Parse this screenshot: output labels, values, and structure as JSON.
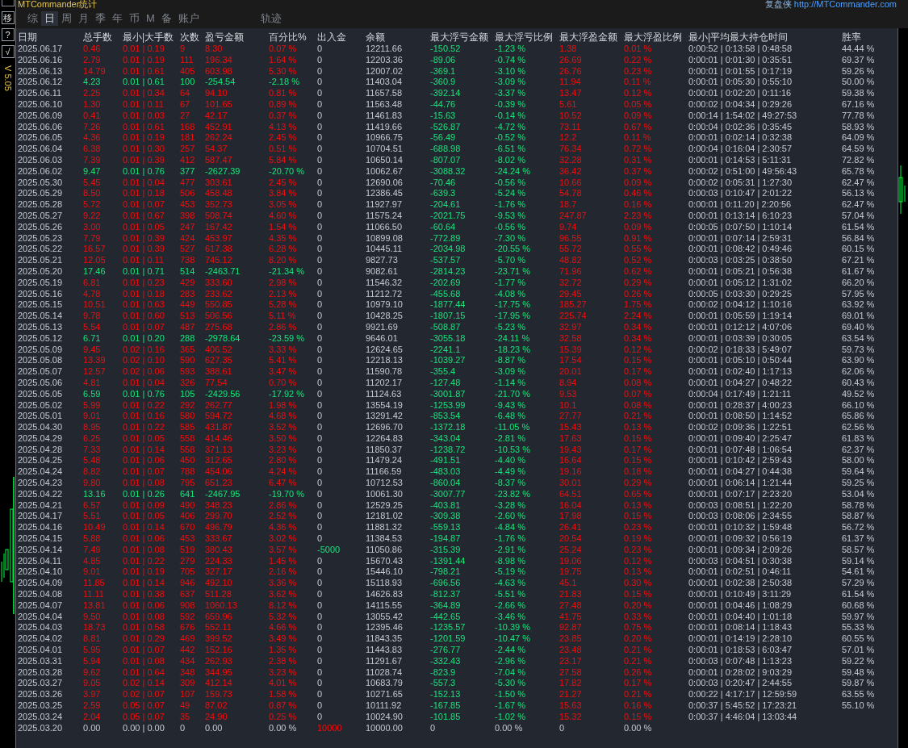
{
  "window": {
    "title": "MTCommander统计",
    "brand": "复盘侠",
    "link": "http://MTCommander.com"
  },
  "side_buttons": [
    "移",
    "?",
    "√"
  ],
  "version": "V 5.05",
  "tabs": [
    {
      "label": "综",
      "selected": false
    },
    {
      "label": "日",
      "selected": true
    },
    {
      "label": "周",
      "selected": false
    },
    {
      "label": "月",
      "selected": false
    },
    {
      "label": "季",
      "selected": false
    },
    {
      "label": "年",
      "selected": false
    },
    {
      "label": "币",
      "selected": false
    },
    {
      "label": "M",
      "selected": false
    },
    {
      "label": "备",
      "selected": false
    },
    {
      "label": "账户",
      "selected": false
    },
    {
      "label": "轨迹",
      "selected": false
    }
  ],
  "table": {
    "columns": [
      "日期",
      "总手数",
      "最小|大手数",
      "次数",
      "盈亏金额",
      "百分比%",
      "出入金",
      "余额",
      "最大浮亏金额",
      "最大浮亏比例",
      "最大浮盈金额",
      "最大浮盈比例",
      "最小|平均最大持仓时间",
      "胜率"
    ],
    "rows": [
      {
        "kind": "gain",
        "deposit": false,
        "withdrawal": false,
        "cells": [
          "2025.06.17",
          "0.46",
          "0.01 | 0.19",
          "9",
          "8.30",
          "0.07 %",
          "0",
          "12211.66",
          "-150.52",
          "-1.23 %",
          "1.38",
          "0.01 %",
          "0:00:52 | 0:13:58 | 0:48:58",
          "44.44 %"
        ]
      },
      {
        "kind": "gain",
        "deposit": false,
        "withdrawal": false,
        "cells": [
          "2025.06.16",
          "2.79",
          "0.01 | 0.19",
          "111",
          "196.34",
          "1.64 %",
          "0",
          "12203.36",
          "-89.06",
          "-0.74 %",
          "26.69",
          "0.22 %",
          "0:00:01 | 0:01:30 | 0:35:51",
          "69.37 %"
        ]
      },
      {
        "kind": "gain",
        "deposit": false,
        "withdrawal": false,
        "cells": [
          "2025.06.13",
          "14.79",
          "0.01 | 0.61",
          "405",
          "603.98",
          "5.30 %",
          "0",
          "12007.02",
          "-369.1",
          "-3.10 %",
          "26.76",
          "0.23 %",
          "0:00:01 | 0:01:55 | 0:17:19",
          "59.26 %"
        ]
      },
      {
        "kind": "loss",
        "deposit": false,
        "withdrawal": false,
        "cells": [
          "2025.06.12",
          "4.23",
          "0.01 | 0.61",
          "100",
          "-254.54",
          "-2.18 %",
          "0",
          "11403.04",
          "-360.9",
          "-3.09 %",
          "11.94",
          "0.11 %",
          "0:00:01 | 0:05:30 | 0:55:10",
          "50.00 %"
        ]
      },
      {
        "kind": "gain",
        "deposit": false,
        "withdrawal": false,
        "cells": [
          "2025.06.11",
          "2.25",
          "0.01 | 0.34",
          "64",
          "94.10",
          "0.81 %",
          "0",
          "11657.58",
          "-392.14",
          "-3.37 %",
          "13.47",
          "0.12 %",
          "0:00:01 | 0:02:20 | 0:11:16",
          "59.38 %"
        ]
      },
      {
        "kind": "gain",
        "deposit": false,
        "withdrawal": false,
        "cells": [
          "2025.06.10",
          "1.30",
          "0.01 | 0.11",
          "67",
          "101.65",
          "0.89 %",
          "0",
          "11563.48",
          "-44.76",
          "-0.39 %",
          "5.61",
          "0.05 %",
          "0:00:02 | 0:04:34 | 0:29:26",
          "67.16 %"
        ]
      },
      {
        "kind": "gain",
        "deposit": false,
        "withdrawal": false,
        "cells": [
          "2025.06.09",
          "0.41",
          "0.01 | 0.03",
          "27",
          "42.17",
          "0.37 %",
          "0",
          "11461.83",
          "-15.63",
          "-0.14 %",
          "10.52",
          "0.09 %",
          "0:00:14 | 1:54:02 | 49:27:53",
          "77.78 %"
        ]
      },
      {
        "kind": "gain",
        "deposit": false,
        "withdrawal": false,
        "cells": [
          "2025.06.06",
          "7.26",
          "0.01 | 0.61",
          "168",
          "452.91",
          "4.13 %",
          "0",
          "11419.66",
          "-526.87",
          "-4.72 %",
          "73.11",
          "0.67 %",
          "0:00:04 | 0:02:36 | 0:35:45",
          "58.93 %"
        ]
      },
      {
        "kind": "gain",
        "deposit": false,
        "withdrawal": false,
        "cells": [
          "2025.06.05",
          "4.36",
          "0.01 | 0.19",
          "181",
          "262.24",
          "2.45 %",
          "0",
          "10966.75",
          "-56.49",
          "-0.52 %",
          "12.2",
          "0.11 %",
          "0:00:01 | 0:02:14 | 0:32:38",
          "64.09 %"
        ]
      },
      {
        "kind": "gain",
        "deposit": false,
        "withdrawal": false,
        "cells": [
          "2025.06.04",
          "6.38",
          "0.01 | 0.30",
          "257",
          "54.37",
          "0.51 %",
          "0",
          "10704.51",
          "-688.98",
          "-6.51 %",
          "76.34",
          "0.72 %",
          "0:00:04 | 0:16:04 | 2:30:57",
          "64.59 %"
        ]
      },
      {
        "kind": "gain",
        "deposit": false,
        "withdrawal": false,
        "cells": [
          "2025.06.03",
          "7.39",
          "0.01 | 0.39",
          "412",
          "587.47",
          "5.84 %",
          "0",
          "10650.14",
          "-807.07",
          "-8.02 %",
          "32.28",
          "0.31 %",
          "0:00:01 | 0:14:53 | 5:11:31",
          "72.82 %"
        ]
      },
      {
        "kind": "loss",
        "deposit": false,
        "withdrawal": false,
        "cells": [
          "2025.06.02",
          "9.47",
          "0.01 | 0.76",
          "377",
          "-2627.39",
          "-20.70 %",
          "0",
          "10062.67",
          "-3088.32",
          "-24.24 %",
          "36.42",
          "0.37 %",
          "0:00:02 | 0:51:00 | 49:56:43",
          "65.78 %"
        ]
      },
      {
        "kind": "gain",
        "deposit": false,
        "withdrawal": false,
        "cells": [
          "2025.05.30",
          "5.45",
          "0.01 | 0.04",
          "477",
          "303.61",
          "2.45 %",
          "0",
          "12690.06",
          "-70.46",
          "-0.56 %",
          "10.66",
          "0.09 %",
          "0:00:02 | 0:05:31 | 1:27:30",
          "62.47 %"
        ]
      },
      {
        "kind": "gain",
        "deposit": false,
        "withdrawal": false,
        "cells": [
          "2025.05.29",
          "8.50",
          "0.01 | 0.18",
          "506",
          "458.48",
          "3.84 %",
          "0",
          "12386.45",
          "-639.3",
          "-5.24 %",
          "54.78",
          "0.46 %",
          "0:00:03 | 0:10:47 | 2:01:22",
          "56.13 %"
        ]
      },
      {
        "kind": "gain",
        "deposit": false,
        "withdrawal": false,
        "cells": [
          "2025.05.28",
          "5.72",
          "0.01 | 0.07",
          "453",
          "352.73",
          "3.05 %",
          "0",
          "11927.97",
          "-204.61",
          "-1.76 %",
          "18.7",
          "0.16 %",
          "0:00:01 | 0:11:20 | 2:20:56",
          "62.47 %"
        ]
      },
      {
        "kind": "gain",
        "deposit": false,
        "withdrawal": false,
        "cells": [
          "2025.05.27",
          "9.22",
          "0.01 | 0.67",
          "398",
          "508.74",
          "4.60 %",
          "0",
          "11575.24",
          "-2021.75",
          "-9.53 %",
          "247.87",
          "2.23 %",
          "0:00:01 | 0:13:14 | 6:10:23",
          "57.04 %"
        ]
      },
      {
        "kind": "gain",
        "deposit": false,
        "withdrawal": false,
        "cells": [
          "2025.05.26",
          "3.00",
          "0.01 | 0.05",
          "247",
          "167.42",
          "1.54 %",
          "0",
          "11066.50",
          "-60.64",
          "-0.56 %",
          "9.74",
          "0.09 %",
          "0:00:05 | 0:07:50 | 1:10:14",
          "61.54 %"
        ]
      },
      {
        "kind": "gain",
        "deposit": false,
        "withdrawal": false,
        "cells": [
          "2025.05.23",
          "7.79",
          "0.01 | 0.39",
          "424",
          "453.97",
          "4.35 %",
          "0",
          "10899.08",
          "-772.89",
          "-7.30 %",
          "96.55",
          "0.91 %",
          "0:00:01 | 0:07:14 | 2:59:31",
          "56.84 %"
        ]
      },
      {
        "kind": "gain",
        "deposit": false,
        "withdrawal": false,
        "cells": [
          "2025.05.22",
          "16.57",
          "0.01 | 0.39",
          "527",
          "617.38",
          "6.28 %",
          "0",
          "10445.11",
          "-2034.98",
          "-20.55 %",
          "55.72",
          "0.55 %",
          "0:00:01 | 0:08:42 | 0:49:46",
          "60.15 %"
        ]
      },
      {
        "kind": "gain",
        "deposit": false,
        "withdrawal": false,
        "cells": [
          "2025.05.21",
          "12.05",
          "0.01 | 0.11",
          "738",
          "745.12",
          "8.20 %",
          "0",
          "9827.73",
          "-537.57",
          "-5.70 %",
          "48.82",
          "0.52 %",
          "0:00:03 | 0:03:25 | 0:38:50",
          "67.21 %"
        ]
      },
      {
        "kind": "loss",
        "deposit": false,
        "withdrawal": false,
        "cells": [
          "2025.05.20",
          "17.46",
          "0.01 | 0.71",
          "514",
          "-2463.71",
          "-21.34 %",
          "0",
          "9082.61",
          "-2814.23",
          "-23.71 %",
          "71.96",
          "0.62 %",
          "0:00:01 | 0:05:21 | 0:56:38",
          "61.67 %"
        ]
      },
      {
        "kind": "gain",
        "deposit": false,
        "withdrawal": false,
        "cells": [
          "2025.05.19",
          "6.81",
          "0.01 | 0.23",
          "429",
          "333.60",
          "2.98 %",
          "0",
          "11546.32",
          "-202.69",
          "-1.77 %",
          "32.72",
          "0.29 %",
          "0:00:01 | 0:05:12 | 1:31:02",
          "66.20 %"
        ]
      },
      {
        "kind": "gain",
        "deposit": false,
        "withdrawal": false,
        "cells": [
          "2025.05.16",
          "4.78",
          "0.01 | 0.18",
          "283",
          "233.62",
          "2.13 %",
          "0",
          "11212.72",
          "-455.68",
          "-4.08 %",
          "29.45",
          "0.26 %",
          "0:00:05 | 0:03:30 | 0:29:25",
          "57.95 %"
        ]
      },
      {
        "kind": "gain",
        "deposit": false,
        "withdrawal": false,
        "cells": [
          "2025.05.15",
          "10.51",
          "0.01 | 0.63",
          "449",
          "550.85",
          "5.28 %",
          "0",
          "10979.10",
          "-1877.44",
          "-17.75 %",
          "185.27",
          "1.75 %",
          "0:00:02 | 0:04:12 | 1:10:16",
          "63.92 %"
        ]
      },
      {
        "kind": "gain",
        "deposit": false,
        "withdrawal": false,
        "cells": [
          "2025.05.14",
          "9.78",
          "0.01 | 0.60",
          "513",
          "506.56",
          "5.11 %",
          "0",
          "10428.25",
          "-1807.15",
          "-17.95 %",
          "225.74",
          "2.24 %",
          "0:00:01 | 0:05:59 | 1:19:14",
          "69.01 %"
        ]
      },
      {
        "kind": "gain",
        "deposit": false,
        "withdrawal": false,
        "cells": [
          "2025.05.13",
          "5.54",
          "0.01 | 0.07",
          "487",
          "275.68",
          "2.86 %",
          "0",
          "9921.69",
          "-508.87",
          "-5.23 %",
          "32.97",
          "0.34 %",
          "0:00:01 | 0:12:12 | 4:07:06",
          "69.40 %"
        ]
      },
      {
        "kind": "loss",
        "deposit": false,
        "withdrawal": false,
        "cells": [
          "2025.05.12",
          "6.71",
          "0.01 | 0.20",
          "288",
          "-2978.64",
          "-23.59 %",
          "0",
          "9646.01",
          "-3055.18",
          "-24.11 %",
          "32.58",
          "0.34 %",
          "0:00:01 | 0:03:39 | 0:30:05",
          "63.54 %"
        ]
      },
      {
        "kind": "gain",
        "deposit": false,
        "withdrawal": false,
        "cells": [
          "2025.05.09",
          "9.45",
          "0.02 | 0.16",
          "365",
          "406.52",
          "3.33 %",
          "0",
          "12624.65",
          "-2241.1",
          "-18.23 %",
          "15.39",
          "0.12 %",
          "0:00:02 | 0:18:33 | 5:49:07",
          "59.73 %"
        ]
      },
      {
        "kind": "gain",
        "deposit": false,
        "withdrawal": false,
        "cells": [
          "2025.05.08",
          "13.39",
          "0.02 | 0.10",
          "590",
          "627.35",
          "5.41 %",
          "0",
          "12218.13",
          "-1039.27",
          "-8.87 %",
          "17.54",
          "0.15 %",
          "0:00:01 | 0:05:10 | 0:50:44",
          "63.90 %"
        ]
      },
      {
        "kind": "gain",
        "deposit": false,
        "withdrawal": false,
        "cells": [
          "2025.05.07",
          "12.57",
          "0.02 | 0.06",
          "593",
          "388.61",
          "3.47 %",
          "0",
          "11590.78",
          "-355.4",
          "-3.09 %",
          "20.01",
          "0.17 %",
          "0:00:01 | 0:02:40 | 1:17:13",
          "62.06 %"
        ]
      },
      {
        "kind": "gain",
        "deposit": false,
        "withdrawal": false,
        "cells": [
          "2025.05.06",
          "4.81",
          "0.01 | 0.04",
          "326",
          "77.54",
          "0.70 %",
          "0",
          "11202.17",
          "-127.48",
          "-1.14 %",
          "8.94",
          "0.08 %",
          "0:00:01 | 0:04:27 | 0:48:22",
          "60.43 %"
        ]
      },
      {
        "kind": "loss",
        "deposit": false,
        "withdrawal": false,
        "cells": [
          "2025.05.05",
          "6.59",
          "0.01 | 0.76",
          "105",
          "-2429.56",
          "-17.92 %",
          "0",
          "11124.63",
          "-3001.87",
          "-21.70 %",
          "9.53",
          "0.07 %",
          "0:00:04 | 0:17:49 | 1:21:11",
          "49.52 %"
        ]
      },
      {
        "kind": "gain",
        "deposit": false,
        "withdrawal": false,
        "cells": [
          "2025.05.02",
          "5.99",
          "0.01 | 0.22",
          "292",
          "262.77",
          "1.98 %",
          "0",
          "13554.19",
          "-1253.99",
          "-9.43 %",
          "10.1",
          "0.08 %",
          "0:00:01 | 0:28:37 | 4:00:23",
          "66.10 %"
        ]
      },
      {
        "kind": "gain",
        "deposit": false,
        "withdrawal": false,
        "cells": [
          "2025.05.01",
          "9.01",
          "0.01 | 0.16",
          "580",
          "594.72",
          "4.68 %",
          "0",
          "13291.42",
          "-853.54",
          "-6.48 %",
          "27.77",
          "0.21 %",
          "0:00:01 | 0:08:50 | 1:14:52",
          "65.86 %"
        ]
      },
      {
        "kind": "gain",
        "deposit": false,
        "withdrawal": false,
        "cells": [
          "2025.04.30",
          "8.95",
          "0.01 | 0.22",
          "585",
          "431.87",
          "3.52 %",
          "0",
          "12696.70",
          "-1372.18",
          "-11.05 %",
          "15.43",
          "0.13 %",
          "0:00:02 | 0:09:36 | 1:22:51",
          "62.56 %"
        ]
      },
      {
        "kind": "gain",
        "deposit": false,
        "withdrawal": false,
        "cells": [
          "2025.04.29",
          "6.25",
          "0.01 | 0.05",
          "558",
          "414.46",
          "3.50 %",
          "0",
          "12264.83",
          "-343.04",
          "-2.81 %",
          "17.63",
          "0.15 %",
          "0:00:01 | 0:09:40 | 2:25:47",
          "61.83 %"
        ]
      },
      {
        "kind": "gain",
        "deposit": false,
        "withdrawal": false,
        "cells": [
          "2025.04.28",
          "7.33",
          "0.01 | 0.14",
          "558",
          "371.13",
          "3.23 %",
          "0",
          "11850.37",
          "-1238.72",
          "-10.53 %",
          "19.43",
          "0.17 %",
          "0:00:01 | 0:07:48 | 1:06:54",
          "62.37 %"
        ]
      },
      {
        "kind": "gain",
        "deposit": false,
        "withdrawal": false,
        "cells": [
          "2025.04.25",
          "5.48",
          "0.01 | 0.06",
          "450",
          "312.65",
          "2.80 %",
          "0",
          "11479.24",
          "-491.51",
          "-4.40 %",
          "16.64",
          "0.15 %",
          "0:00:01 | 0:10:42 | 2:59:43",
          "58.00 %"
        ]
      },
      {
        "kind": "gain",
        "deposit": false,
        "withdrawal": false,
        "cells": [
          "2025.04.24",
          "8.82",
          "0.01 | 0.07",
          "788",
          "454.06",
          "4.24 %",
          "0",
          "11166.59",
          "-483.03",
          "-4.49 %",
          "19.16",
          "0.18 %",
          "0:00:01 | 0:04:27 | 0:44:38",
          "59.64 %"
        ]
      },
      {
        "kind": "gain",
        "deposit": false,
        "withdrawal": false,
        "cells": [
          "2025.04.23",
          "9.80",
          "0.01 | 0.08",
          "795",
          "651.23",
          "6.47 %",
          "0",
          "10712.53",
          "-860.04",
          "-8.37 %",
          "30.01",
          "0.29 %",
          "0:00:01 | 0:06:14 | 1:21:44",
          "59.25 %"
        ]
      },
      {
        "kind": "loss",
        "deposit": false,
        "withdrawal": false,
        "cells": [
          "2025.04.22",
          "13.16",
          "0.01 | 0.26",
          "641",
          "-2467.95",
          "-19.70 %",
          "0",
          "10061.30",
          "-3007.77",
          "-23.82 %",
          "64.51",
          "0.65 %",
          "0:00:01 | 0:07:17 | 2:23:20",
          "53.04 %"
        ]
      },
      {
        "kind": "gain",
        "deposit": false,
        "withdrawal": false,
        "cells": [
          "2025.04.21",
          "6.57",
          "0.01 | 0.09",
          "490",
          "348.23",
          "2.86 %",
          "0",
          "12529.25",
          "-403.81",
          "-3.28 %",
          "16.04",
          "0.13 %",
          "0:00:03 | 0:08:51 | 1:22:20",
          "58.78 %"
        ]
      },
      {
        "kind": "gain",
        "deposit": false,
        "withdrawal": false,
        "cells": [
          "2025.04.17",
          "5.51",
          "0.01 | 0.05",
          "406",
          "299.70",
          "2.52 %",
          "0",
          "12181.02",
          "-309.38",
          "-2.60 %",
          "17.98",
          "0.15 %",
          "0:00:03 | 0:08:06 | 2:34:55",
          "58.87 %"
        ]
      },
      {
        "kind": "gain",
        "deposit": false,
        "withdrawal": false,
        "cells": [
          "2025.04.16",
          "10.49",
          "0.01 | 0.14",
          "670",
          "496.79",
          "4.36 %",
          "0",
          "11881.32",
          "-559.13",
          "-4.84 %",
          "26.41",
          "0.23 %",
          "0:00:01 | 0:10:32 | 1:59:48",
          "56.72 %"
        ]
      },
      {
        "kind": "gain",
        "deposit": false,
        "withdrawal": false,
        "cells": [
          "2025.04.15",
          "5.88",
          "0.01 | 0.06",
          "453",
          "333.67",
          "3.02 %",
          "0",
          "11384.53",
          "-194.87",
          "-1.76 %",
          "20.54",
          "0.19 %",
          "0:00:01 | 0:09:32 | 0:56:19",
          "61.37 %"
        ]
      },
      {
        "kind": "gain",
        "deposit": false,
        "withdrawal": true,
        "cells": [
          "2025.04.14",
          "7.49",
          "0.01 | 0.08",
          "519",
          "380.43",
          "3.57 %",
          "-5000",
          "11050.86",
          "-315.39",
          "-2.91 %",
          "25.24",
          "0.23 %",
          "0:00:01 | 0:09:34 | 2:09:26",
          "58.57 %"
        ]
      },
      {
        "kind": "gain",
        "deposit": false,
        "withdrawal": false,
        "cells": [
          "2025.04.11",
          "4.85",
          "0.01 | 0.22",
          "279",
          "224.33",
          "1.45 %",
          "0",
          "15670.43",
          "-1391.44",
          "-8.98 %",
          "19.06",
          "0.12 %",
          "0:00:03 | 0:04:51 | 0:30:38",
          "59.14 %"
        ]
      },
      {
        "kind": "gain",
        "deposit": false,
        "withdrawal": false,
        "cells": [
          "2025.04.10",
          "9.01",
          "0.01 | 0.19",
          "705",
          "327.17",
          "2.16 %",
          "0",
          "15446.10",
          "-798.21",
          "-5.19 %",
          "19.75",
          "0.13 %",
          "0:00:01 | 0:02:51 | 0:46:11",
          "54.61 %"
        ]
      },
      {
        "kind": "gain",
        "deposit": false,
        "withdrawal": false,
        "cells": [
          "2025.04.09",
          "11.85",
          "0.01 | 0.14",
          "946",
          "492.10",
          "3.36 %",
          "0",
          "15118.93",
          "-696.56",
          "-4.63 %",
          "45.1",
          "0.30 %",
          "0:00:01 | 0:02:38 | 2:50:38",
          "57.29 %"
        ]
      },
      {
        "kind": "gain",
        "deposit": false,
        "withdrawal": false,
        "cells": [
          "2025.04.08",
          "11.11",
          "0.01 | 0.38",
          "637",
          "511.28",
          "3.62 %",
          "0",
          "14626.83",
          "-812.37",
          "-5.51 %",
          "21.83",
          "0.15 %",
          "0:00:01 | 0:10:49 | 3:11:29",
          "61.54 %"
        ]
      },
      {
        "kind": "gain",
        "deposit": false,
        "withdrawal": false,
        "cells": [
          "2025.04.07",
          "13.81",
          "0.01 | 0.06",
          "908",
          "1060.13",
          "8.12 %",
          "0",
          "14115.55",
          "-364.89",
          "-2.66 %",
          "27.48",
          "0.20 %",
          "0:00:01 | 0:04:46 | 1:08:29",
          "60.68 %"
        ]
      },
      {
        "kind": "gain",
        "deposit": false,
        "withdrawal": false,
        "cells": [
          "2025.04.04",
          "9.50",
          "0.01 | 0.08",
          "592",
          "659.96",
          "5.32 %",
          "0",
          "13055.42",
          "-442.65",
          "-3.46 %",
          "41.75",
          "0.33 %",
          "0:00:01 | 0:04:40 | 1:01:18",
          "59.97 %"
        ]
      },
      {
        "kind": "gain",
        "deposit": false,
        "withdrawal": false,
        "cells": [
          "2025.04.03",
          "18.73",
          "0.01 | 0.58",
          "676",
          "552.11",
          "4.66 %",
          "0",
          "12395.46",
          "-1235.57",
          "-10.39 %",
          "92.87",
          "0.75 %",
          "0:00:01 | 0:08:14 | 1:18:43",
          "55.33 %"
        ]
      },
      {
        "kind": "gain",
        "deposit": false,
        "withdrawal": false,
        "cells": [
          "2025.04.02",
          "8.81",
          "0.01 | 0.29",
          "469",
          "399.52",
          "3.49 %",
          "0",
          "11843.35",
          "-1201.59",
          "-10.47 %",
          "23.85",
          "0.20 %",
          "0:00:01 | 0:14:19 | 2:28:10",
          "60.55 %"
        ]
      },
      {
        "kind": "gain",
        "deposit": false,
        "withdrawal": false,
        "cells": [
          "2025.04.01",
          "5.95",
          "0.01 | 0.07",
          "442",
          "152.16",
          "1.35 %",
          "0",
          "11443.83",
          "-276.77",
          "-2.44 %",
          "23.48",
          "0.21 %",
          "0:00:01 | 0:18:53 | 6:03:47",
          "57.01 %"
        ]
      },
      {
        "kind": "gain",
        "deposit": false,
        "withdrawal": false,
        "cells": [
          "2025.03.31",
          "5.94",
          "0.01 | 0.08",
          "434",
          "262.93",
          "2.38 %",
          "0",
          "11291.67",
          "-332.43",
          "-2.96 %",
          "23.17",
          "0.21 %",
          "0:00:03 | 0:07:48 | 1:13:23",
          "59.22 %"
        ]
      },
      {
        "kind": "gain",
        "deposit": false,
        "withdrawal": false,
        "cells": [
          "2025.03.28",
          "9.62",
          "0.01 | 0.64",
          "348",
          "344.95",
          "3.23 %",
          "0",
          "11028.74",
          "-823.9",
          "-7.04 %",
          "27.58",
          "0.26 %",
          "0:00:01 | 0:28:02 | 9:03:29",
          "59.48 %"
        ]
      },
      {
        "kind": "gain",
        "deposit": false,
        "withdrawal": false,
        "cells": [
          "2025.03.27",
          "9.05",
          "0.02 | 0.14",
          "309",
          "412.14",
          "4.01 %",
          "0",
          "10683.79",
          "-557.3",
          "-5.30 %",
          "17.82",
          "0.17 %",
          "0:00:03 | 0:20:47 | 2:44:55",
          "59.87 %"
        ]
      },
      {
        "kind": "gain",
        "deposit": false,
        "withdrawal": false,
        "cells": [
          "2025.03.26",
          "3.97",
          "0.02 | 0.07",
          "107",
          "159.73",
          "1.58 %",
          "0",
          "10271.65",
          "-152.13",
          "-1.50 %",
          "21.27",
          "0.21 %",
          "0:00:22 | 4:17:17 | 12:59:59",
          "63.55 %"
        ]
      },
      {
        "kind": "gain",
        "deposit": false,
        "withdrawal": false,
        "cells": [
          "2025.03.25",
          "2.59",
          "0.05 | 0.07",
          "49",
          "87.02",
          "0.87 %",
          "0",
          "10111.92",
          "-167.85",
          "-1.67 %",
          "15.63",
          "0.16 %",
          "0:00:37 | 5:45:52 | 17:23:21",
          "55.10 %"
        ]
      },
      {
        "kind": "gain",
        "deposit": false,
        "withdrawal": false,
        "cells": [
          "2025.03.24",
          "2.04",
          "0.05 | 0.07",
          "35",
          "24.90",
          "0.25 %",
          "0",
          "10024.90",
          "-101.85",
          "-1.02 %",
          "15.32",
          "0.15 %",
          "0:00:37 | 4:46:04 | 13:03:44"
        ]
      },
      {
        "kind": "flat",
        "deposit": true,
        "withdrawal": false,
        "cells": [
          "2025.03.20",
          "0.00",
          "0.00 | 0.00",
          "0",
          "0.00",
          "0.00 %",
          "10000",
          "10000.00",
          "0",
          "0.00 %",
          "0",
          "0.00 %"
        ]
      }
    ]
  }
}
